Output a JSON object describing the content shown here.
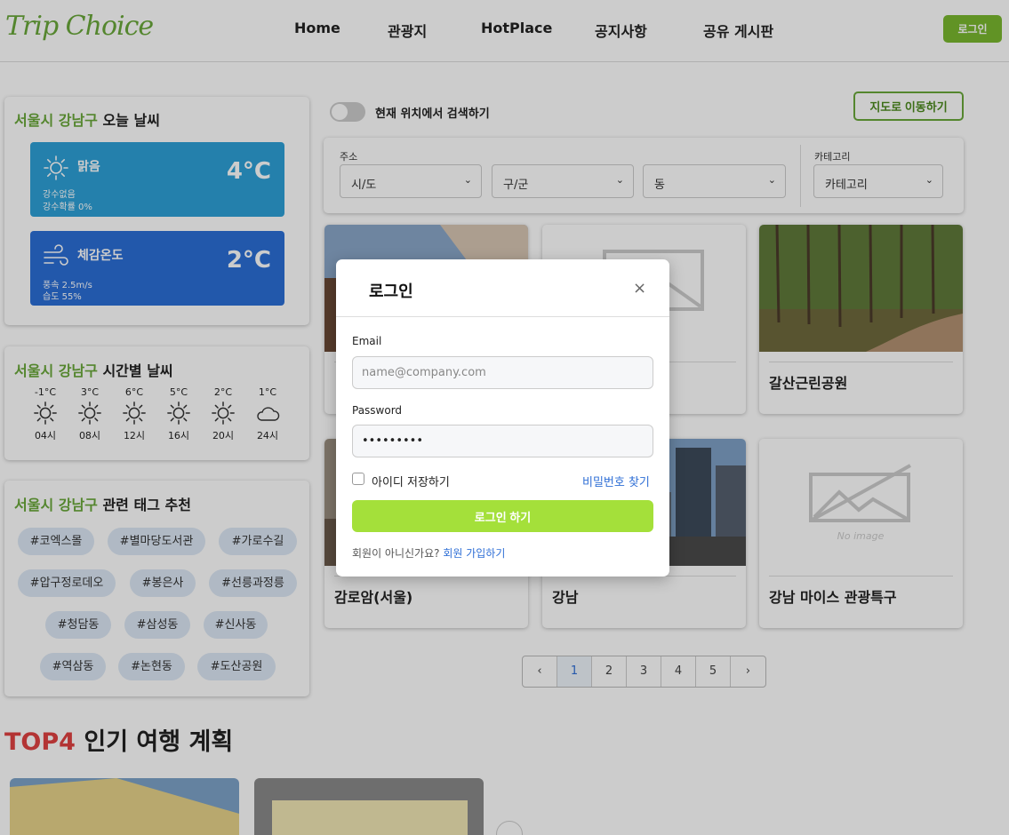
{
  "header": {
    "logo": "Trip Choice",
    "nav": [
      "Home",
      "관광지",
      "HotPlace",
      "공지사항",
      "공유 게시판"
    ],
    "login_label": "로그인"
  },
  "weather_today": {
    "location": "서울시 강남구",
    "title_suffix": " 오늘 날씨",
    "condition": "맑음",
    "temp": "4°C",
    "line1": "강수없음",
    "line2": "강수확률 0%",
    "feels_label": "체감온도",
    "feels_temp": "2°C",
    "wind": "풍속 2.5m/s",
    "humidity": "습도 55%",
    "colors": {
      "sunny_box": "#2ea0d8",
      "feels_box": "#2b6fd6"
    }
  },
  "weather_hourly": {
    "location": "서울시 강남구",
    "title_suffix": " 시간별 날씨",
    "items": [
      {
        "temp": "-1°C",
        "time": "04시",
        "icon": "sun-icon"
      },
      {
        "temp": "3°C",
        "time": "08시",
        "icon": "sun-icon"
      },
      {
        "temp": "6°C",
        "time": "12시",
        "icon": "sun-icon"
      },
      {
        "temp": "5°C",
        "time": "16시",
        "icon": "sun-icon"
      },
      {
        "temp": "2°C",
        "time": "20시",
        "icon": "sun-icon"
      },
      {
        "temp": "1°C",
        "time": "24시",
        "icon": "cloud-icon"
      }
    ]
  },
  "tags": {
    "location": "서울시 강남구",
    "title_suffix": " 관련 태그 추천",
    "items": [
      "#코엑스몰",
      "#별마당도서관",
      "#가로수길",
      "#압구정로데오",
      "#봉은사",
      "#선릉과정릉",
      "#청담동",
      "#삼성동",
      "#신사동",
      "#역삼동",
      "#논현동",
      "#도산공원"
    ]
  },
  "search": {
    "toggle_label": "현재 위치에서 검색하기",
    "map_button": "지도로 이동하기",
    "address_label": "주소",
    "category_label": "카테고리",
    "selects": [
      "시/도",
      "구/군",
      "동",
      "카테고리"
    ]
  },
  "places": [
    {
      "name": "",
      "image": "rooftop-photo"
    },
    {
      "name": "",
      "image": "no-image"
    },
    {
      "name": "갈산근린공원",
      "image": "forest-photo"
    },
    {
      "name": "감로암(서울)",
      "image": "temple-photo"
    },
    {
      "name": "강남",
      "image": "city-photo"
    },
    {
      "name": "강남 마이스 관광특구",
      "image": "no-image"
    }
  ],
  "no_image_text": "No image",
  "pagination": {
    "prev": "‹",
    "pages": [
      "1",
      "2",
      "3",
      "4",
      "5"
    ],
    "next": "›",
    "current": "1"
  },
  "popular": {
    "rank": "TOP4",
    "title": " 인기 여행 계획"
  },
  "modal": {
    "title": "로그인",
    "close": "×",
    "email_label": "Email",
    "email_placeholder": "name@company.com",
    "password_label": "Password",
    "password_value": "•••••••••",
    "remember_label": "아이디 저장하기",
    "find_password": "비밀번호 찾기",
    "submit": "로그인 하기",
    "signup_question": "회원이 아니신가요? ",
    "signup_link": "회원 가입하기"
  }
}
